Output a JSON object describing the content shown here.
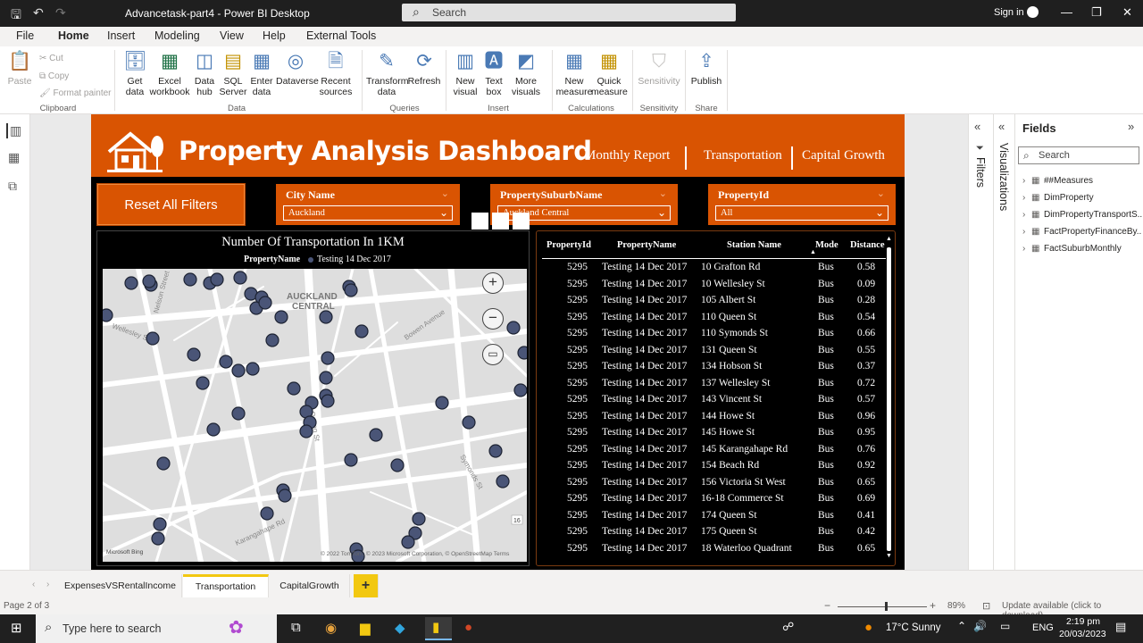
{
  "titlebar": {
    "title": "Advancetask-part4 - Power BI Desktop",
    "search_placeholder": "Search",
    "signin": "Sign in"
  },
  "ribbon_tabs": [
    "File",
    "Home",
    "Insert",
    "Modeling",
    "View",
    "Help",
    "External Tools"
  ],
  "ribbon": {
    "clipboard": {
      "paste": "Paste",
      "cut": "Cut",
      "copy": "Copy",
      "format_painter": "Format painter",
      "group": "Clipboard"
    },
    "data": {
      "get_data": "Get data",
      "excel": "Excel workbook",
      "data_hub": "Data hub",
      "sql": "SQL Server",
      "enter": "Enter data",
      "dataverse": "Dataverse",
      "recent": "Recent sources",
      "group": "Data"
    },
    "queries": {
      "transform": "Transform data",
      "refresh": "Refresh",
      "group": "Queries"
    },
    "insert": {
      "new_visual": "New visual",
      "text_box": "Text box",
      "more_visuals": "More visuals",
      "group": "Insert"
    },
    "calculations": {
      "new_measure": "New measure",
      "quick_measure": "Quick measure",
      "group": "Calculations"
    },
    "sensitivity": {
      "label": "Sensitivity",
      "group": "Sensitivity"
    },
    "share": {
      "publish": "Publish",
      "group": "Share"
    }
  },
  "report": {
    "title": "Property Analysis Dashboard",
    "nav": [
      "Monthly Report",
      "Transportation",
      "Capital Growth"
    ],
    "reset_button": "Reset All Filters",
    "slicers": [
      {
        "label": "City Name",
        "value": "Auckland"
      },
      {
        "label": "PropertySuburbName",
        "value": "Auckland Central"
      },
      {
        "label": "PropertyId",
        "value": "All"
      }
    ],
    "map": {
      "title": "Number Of Transportation In 1KM",
      "legend_label": "PropertyName",
      "legend_item": "Testing 14 Dec 2017",
      "map_label_1": "AUCKLAND",
      "map_label_2": "CENTRAL",
      "attribution": "© 2022 TomTom, © 2023 Microsoft Corporation, © OpenStreetMap Terms",
      "bing": "Microsoft Bing",
      "street_1": "Nelson Street",
      "street_2": "Wellesley St",
      "street_3": "Queen St",
      "street_4": "Symonds St",
      "street_5": "Karangahape Rd",
      "street_6": "Bowen Avenue",
      "road_badge": "16"
    },
    "table": {
      "headers": [
        "PropertyId",
        "PropertyName",
        "Station Name",
        "Mode",
        "Distance"
      ],
      "rows": [
        [
          "5295",
          "Testing 14 Dec 2017",
          "10 Grafton Rd",
          "Bus",
          "0.58"
        ],
        [
          "5295",
          "Testing 14 Dec 2017",
          "10 Wellesley St",
          "Bus",
          "0.09"
        ],
        [
          "5295",
          "Testing 14 Dec 2017",
          "105 Albert St",
          "Bus",
          "0.28"
        ],
        [
          "5295",
          "Testing 14 Dec 2017",
          "110 Queen St",
          "Bus",
          "0.54"
        ],
        [
          "5295",
          "Testing 14 Dec 2017",
          "110 Symonds St",
          "Bus",
          "0.66"
        ],
        [
          "5295",
          "Testing 14 Dec 2017",
          "131 Queen St",
          "Bus",
          "0.55"
        ],
        [
          "5295",
          "Testing 14 Dec 2017",
          "134 Hobson St",
          "Bus",
          "0.37"
        ],
        [
          "5295",
          "Testing 14 Dec 2017",
          "137 Wellesley St",
          "Bus",
          "0.72"
        ],
        [
          "5295",
          "Testing 14 Dec 2017",
          "143 Vincent St",
          "Bus",
          "0.57"
        ],
        [
          "5295",
          "Testing 14 Dec 2017",
          "144 Howe St",
          "Bus",
          "0.96"
        ],
        [
          "5295",
          "Testing 14 Dec 2017",
          "145 Howe St",
          "Bus",
          "0.95"
        ],
        [
          "5295",
          "Testing 14 Dec 2017",
          "145 Karangahape Rd",
          "Bus",
          "0.76"
        ],
        [
          "5295",
          "Testing 14 Dec 2017",
          "154 Beach Rd",
          "Bus",
          "0.92"
        ],
        [
          "5295",
          "Testing 14 Dec 2017",
          "156 Victoria St West",
          "Bus",
          "0.65"
        ],
        [
          "5295",
          "Testing 14 Dec 2017",
          "16-18 Commerce St",
          "Bus",
          "0.69"
        ],
        [
          "5295",
          "Testing 14 Dec 2017",
          "174 Queen St",
          "Bus",
          "0.41"
        ],
        [
          "5295",
          "Testing 14 Dec 2017",
          "175 Queen St",
          "Bus",
          "0.42"
        ],
        [
          "5295",
          "Testing 14 Dec 2017",
          "18 Waterloo Quadrant",
          "Bus",
          "0.65"
        ]
      ]
    }
  },
  "panes": {
    "filters": "Filters",
    "visualizations": "Visualizations",
    "fields_title": "Fields",
    "fields_search": "Search",
    "fields": [
      "##Measures",
      "DimProperty",
      "DimPropertyTransportS...",
      "FactPropertyFinanceBy...",
      "FactSuburbMonthly"
    ]
  },
  "page_tabs": [
    "ExpensesVSRentalIncome",
    "Transportation",
    "CapitalGrowth"
  ],
  "add_page": "+",
  "status": {
    "page": "Page 2 of 3",
    "zoom": "89%",
    "update": "Update available (click to download)"
  },
  "taskbar": {
    "search": "Type here to search",
    "weather": "17°C  Sunny",
    "lang": "ENG",
    "time": "2:19 pm",
    "date": "20/03/2023"
  },
  "colors": {
    "brand_orange": "#d95402",
    "marker": "#4a5577",
    "accent_yellow": "#f2c811"
  }
}
